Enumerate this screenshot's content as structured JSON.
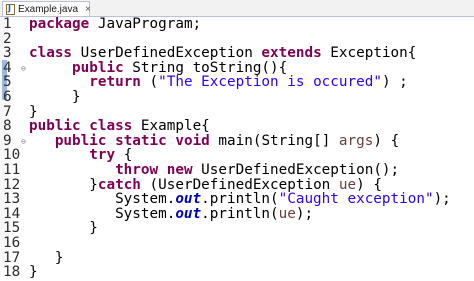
{
  "tab": {
    "title": "Example.java",
    "close": "×",
    "icon": "java-file-icon"
  },
  "colors": {
    "keyword": "#7f0055",
    "string": "#2a00ff",
    "field": "#0000c0",
    "parameter": "#6a3e3e"
  },
  "lines": [
    {
      "num": "1",
      "fold": "",
      "tokens": [
        [
          "kw",
          "package"
        ],
        [
          "t",
          " JavaProgram;"
        ]
      ]
    },
    {
      "num": "2",
      "fold": "",
      "tokens": []
    },
    {
      "num": "3",
      "fold": "",
      "tokens": [
        [
          "kw",
          "class"
        ],
        [
          "t",
          " UserDefinedException "
        ],
        [
          "kw",
          "extends"
        ],
        [
          "t",
          " Exception{"
        ]
      ]
    },
    {
      "num": "4",
      "fold": "⊖",
      "tokens": [
        [
          "t",
          "     "
        ],
        [
          "kw",
          "public"
        ],
        [
          "t",
          " String toString(){"
        ]
      ]
    },
    {
      "num": "5",
      "fold": "",
      "tokens": [
        [
          "t",
          "       "
        ],
        [
          "kw",
          "return"
        ],
        [
          "t",
          " ("
        ],
        [
          "str",
          "\"The Exception is occured\""
        ],
        [
          "t",
          ") ;"
        ]
      ]
    },
    {
      "num": "6",
      "fold": "",
      "tokens": [
        [
          "t",
          "     }"
        ]
      ]
    },
    {
      "num": "7",
      "fold": "",
      "tokens": [
        [
          "t",
          "}"
        ]
      ]
    },
    {
      "num": "8",
      "fold": "",
      "tokens": [
        [
          "kw",
          "public"
        ],
        [
          "t",
          " "
        ],
        [
          "kw",
          "class"
        ],
        [
          "t",
          " Example{"
        ]
      ]
    },
    {
      "num": "9",
      "fold": "⊖",
      "tokens": [
        [
          "t",
          "   "
        ],
        [
          "kw",
          "public"
        ],
        [
          "t",
          " "
        ],
        [
          "kw",
          "static"
        ],
        [
          "t",
          " "
        ],
        [
          "kw",
          "void"
        ],
        [
          "t",
          " main(String[] "
        ],
        [
          "prm",
          "args"
        ],
        [
          "t",
          ") {"
        ]
      ]
    },
    {
      "num": "10",
      "fold": "",
      "tokens": [
        [
          "t",
          "       "
        ],
        [
          "kw",
          "try"
        ],
        [
          "t",
          " {"
        ]
      ]
    },
    {
      "num": "11",
      "fold": "",
      "tokens": [
        [
          "t",
          "          "
        ],
        [
          "kw",
          "throw"
        ],
        [
          "t",
          " "
        ],
        [
          "kw",
          "new"
        ],
        [
          "t",
          " UserDefinedException();"
        ]
      ]
    },
    {
      "num": "12",
      "fold": "",
      "tokens": [
        [
          "t",
          "       }"
        ],
        [
          "kw",
          "catch"
        ],
        [
          "t",
          " (UserDefinedException "
        ],
        [
          "prm",
          "ue"
        ],
        [
          "t",
          ") {"
        ]
      ]
    },
    {
      "num": "13",
      "fold": "",
      "tokens": [
        [
          "t",
          "          System."
        ],
        [
          "fld",
          "out"
        ],
        [
          "t",
          ".println("
        ],
        [
          "str",
          "\"Caught exception\""
        ],
        [
          "t",
          ");"
        ]
      ]
    },
    {
      "num": "14",
      "fold": "",
      "tokens": [
        [
          "t",
          "          System."
        ],
        [
          "fld",
          "out"
        ],
        [
          "t",
          ".println("
        ],
        [
          "prm",
          "ue"
        ],
        [
          "t",
          ");"
        ]
      ]
    },
    {
      "num": "15",
      "fold": "",
      "tokens": [
        [
          "t",
          "       }"
        ]
      ]
    },
    {
      "num": "16",
      "fold": "",
      "tokens": []
    },
    {
      "num": "17",
      "fold": "",
      "tokens": [
        [
          "t",
          "   }"
        ]
      ]
    },
    {
      "num": "18",
      "fold": "",
      "tokens": [
        [
          "t",
          "}"
        ]
      ]
    }
  ]
}
